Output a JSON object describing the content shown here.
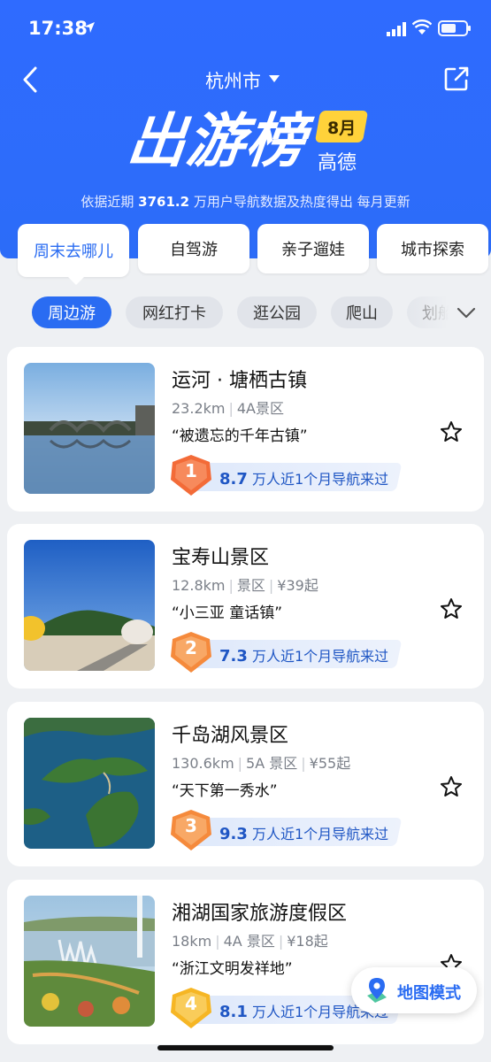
{
  "status": {
    "time": "17:38"
  },
  "header": {
    "city": "杭州市",
    "title": "出游榜",
    "month": "8月",
    "brand": "高德",
    "subtitle_prefix": "依据近期",
    "subtitle_users": "3761.2",
    "subtitle_suffix": "万用户导航数据及热度得出 每月更新",
    "bg_color": "#2c6cf8"
  },
  "tabs": [
    {
      "label": "周末去哪儿",
      "active": true
    },
    {
      "label": "自驾游",
      "active": false
    },
    {
      "label": "亲子遛娃",
      "active": false
    },
    {
      "label": "城市探索",
      "active": false
    }
  ],
  "chips": [
    {
      "label": "周边游",
      "active": true
    },
    {
      "label": "网红打卡",
      "active": false
    },
    {
      "label": "逛公园",
      "active": false
    },
    {
      "label": "爬山",
      "active": false
    },
    {
      "label": "划船",
      "active": false
    }
  ],
  "spots": [
    {
      "rank": "1",
      "name": "运河 · 塘栖古镇",
      "meta": [
        "23.2km",
        "4A景区"
      ],
      "quote": "“被遗忘的千年古镇”",
      "visitors": "8.7",
      "visitors_text": "万人近1个月导航来过",
      "medal_color": "#f36b38"
    },
    {
      "rank": "2",
      "name": "宝寿山景区",
      "meta": [
        "12.8km",
        "景区",
        "¥39起"
      ],
      "quote": "“小三亚 童话镇”",
      "visitors": "7.3",
      "visitors_text": "万人近1个月导航来过",
      "medal_color": "#f58a3c"
    },
    {
      "rank": "3",
      "name": "千岛湖风景区",
      "meta": [
        "130.6km",
        "5A 景区",
        "¥55起"
      ],
      "quote": "“天下第一秀水”",
      "visitors": "9.3",
      "visitors_text": "万人近1个月导航来过",
      "medal_color": "#f58a3c"
    },
    {
      "rank": "4",
      "name": "湘湖国家旅游度假区",
      "meta": [
        "18km",
        "4A 景区",
        "¥18起"
      ],
      "quote": "“浙江文明发祥地”",
      "visitors": "8.1",
      "visitors_text": "万人近1个月导航来过",
      "medal_color": "#f6b624"
    }
  ],
  "map_mode": {
    "label": "地图模式"
  },
  "accent": "#2a6cf2"
}
